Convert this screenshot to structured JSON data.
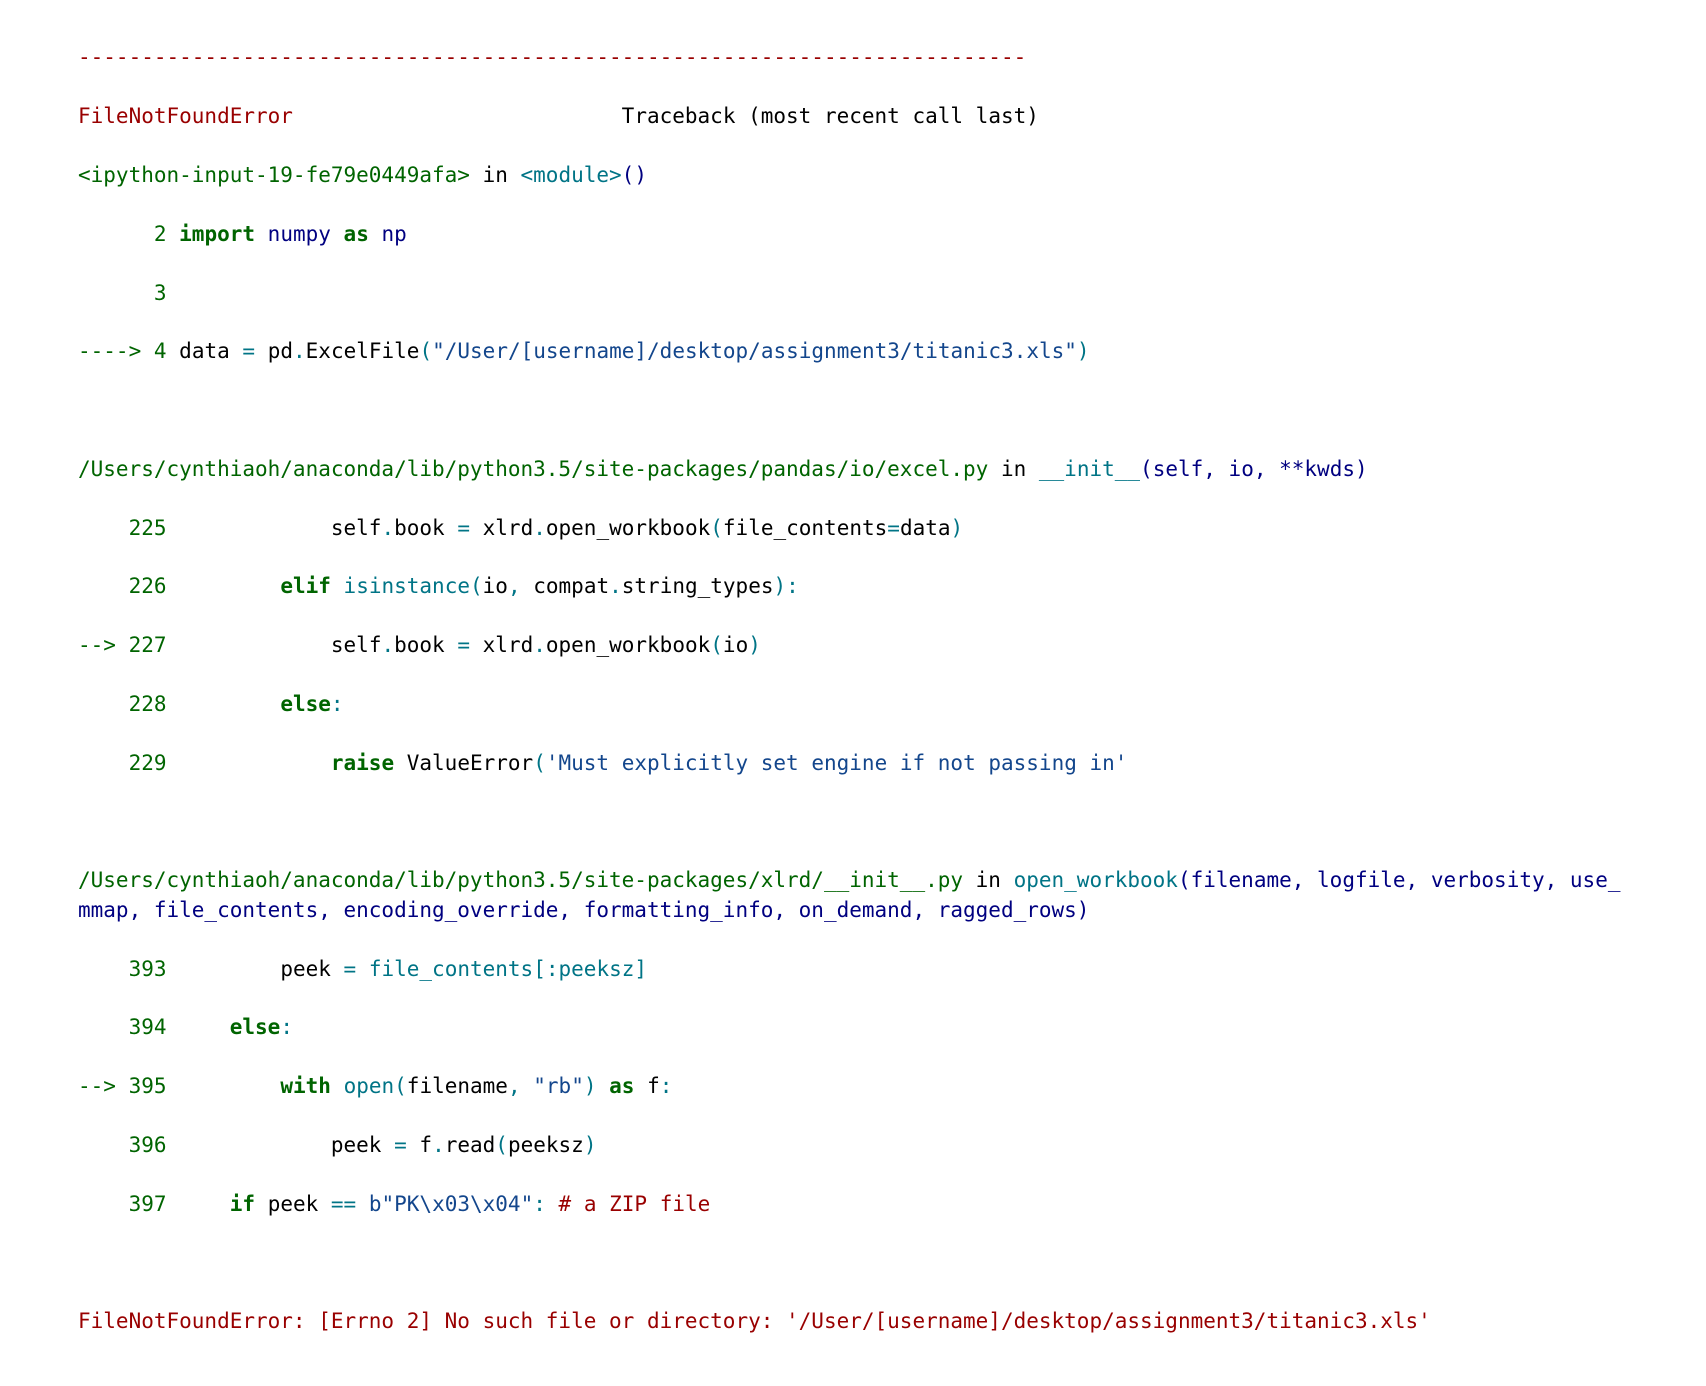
{
  "rule": "---------------------------------------------------------------------------",
  "header": {
    "error_name": "FileNotFoundError",
    "spacer": "                          ",
    "traceback_label": "Traceback (most recent call last)"
  },
  "frame1": {
    "location": "<ipython-input-19-fe79e0449afa>",
    "in": " in ",
    "func": "<module>",
    "parens": "()",
    "lines": [
      {
        "gutter": "      2 ",
        "kw1": "import",
        "sp1": " ",
        "name1": "numpy",
        "sp2": " ",
        "kw2": "as",
        "sp3": " ",
        "name2": "np"
      },
      {
        "gutter": "      3 "
      },
      {
        "arrow": "----> ",
        "lineno": "4",
        "sp1": " ",
        "t_data": "data ",
        "t_eq": "=",
        "sp2": " ",
        "t_pd": "pd",
        "t_dot1": ".",
        "t_excel": "ExcelFile",
        "t_open": "(",
        "t_str": "\"/User/[username]/desktop/assignment3/titanic3.xls\"",
        "t_close": ")"
      }
    ]
  },
  "frame2": {
    "path": "/Users/cynthiaoh/anaconda/lib/python3.5/site-packages/pandas/io/excel.py",
    "in": " in ",
    "func": "__init__",
    "sig": "(self, io, **kwds)",
    "l225": {
      "gutter": "    225 ",
      "indent": "            ",
      "t_self": "self",
      "t_dot": ".",
      "t_book": "book ",
      "t_eq": "=",
      "sp": " ",
      "t_xlrd": "xlrd",
      "t_dot2": ".",
      "t_open": "open_workbook",
      "t_paren": "(",
      "t_kwarg": "file_contents",
      "t_eq2": "=",
      "t_data": "data",
      "t_close": ")"
    },
    "l226": {
      "gutter": "    226 ",
      "indent": "        ",
      "t_elif": "elif",
      "sp": " ",
      "t_isinst": "isinstance",
      "t_open": "(",
      "t_io": "io",
      "t_comma": ",",
      "sp2": " ",
      "t_compat": "compat",
      "t_dot": ".",
      "t_strt": "string_types",
      "t_close": "):"
    },
    "l227": {
      "arrow": "--> ",
      "lineno": "227",
      "sp": " ",
      "indent": "            ",
      "t_self": "self",
      "t_dot": ".",
      "t_book": "book ",
      "t_eq": "=",
      "sp2": " ",
      "t_xlrd": "xlrd",
      "t_dot2": ".",
      "t_open": "open_workbook",
      "t_paren": "(",
      "t_io": "io",
      "t_close": ")"
    },
    "l228": {
      "gutter": "    228 ",
      "indent": "        ",
      "t_else": "else",
      "t_colon": ":"
    },
    "l229": {
      "gutter": "    229 ",
      "indent": "            ",
      "t_raise": "raise",
      "sp": " ",
      "t_ve": "ValueError",
      "t_open": "(",
      "t_str": "'Must explicitly set engine if not passing in'"
    }
  },
  "frame3": {
    "path": "/Users/cynthiaoh/anaconda/lib/python3.5/site-packages/xlrd/__init__.py",
    "in": " in ",
    "func": "open_workbook",
    "sig": "(filename, logfile, verbosity, use_mmap, file_contents, encoding_override, formatting_info, on_demand, ragged_rows)",
    "l393": {
      "gutter": "    393 ",
      "indent": "        ",
      "t_peek": "peek ",
      "t_eq": "=",
      "sp": " ",
      "t_fc": "file_contents",
      "t_br": "[:",
      "t_sz": "peeksz",
      "t_close": "]"
    },
    "l394": {
      "gutter": "    394 ",
      "indent": "    ",
      "t_else": "else",
      "t_colon": ":"
    },
    "l395": {
      "arrow": "--> ",
      "lineno": "395",
      "sp": " ",
      "indent": "        ",
      "t_with": "with",
      "sp2": " ",
      "t_open": "open",
      "t_paren": "(",
      "t_fn": "filename",
      "t_comma": ",",
      "sp3": " ",
      "t_rb": "\"rb\"",
      "t_close": ")",
      "sp4": " ",
      "t_as": "as",
      "sp5": " ",
      "t_f": "f",
      "t_colon": ":"
    },
    "l396": {
      "gutter": "    396 ",
      "indent": "            ",
      "t_peek": "peek ",
      "t_eq": "=",
      "sp": " ",
      "t_f": "f",
      "t_dot": ".",
      "t_read": "read",
      "t_paren": "(",
      "t_sz": "peeksz",
      "t_close": ")"
    },
    "l397": {
      "gutter": "    397 ",
      "indent": "    ",
      "t_if": "if",
      "sp": " ",
      "t_peek": "peek ",
      "t_eqeq": "==",
      "sp2": " ",
      "t_bytes": "b\"PK\\x03\\x04\"",
      "t_colon": ":",
      "sp3": " ",
      "t_comment": "# a ZIP file"
    }
  },
  "final": {
    "msg": "FileNotFoundError: [Errno 2] No such file or directory: '/User/[username]/desktop/assignment3/titanic3.xls'"
  }
}
